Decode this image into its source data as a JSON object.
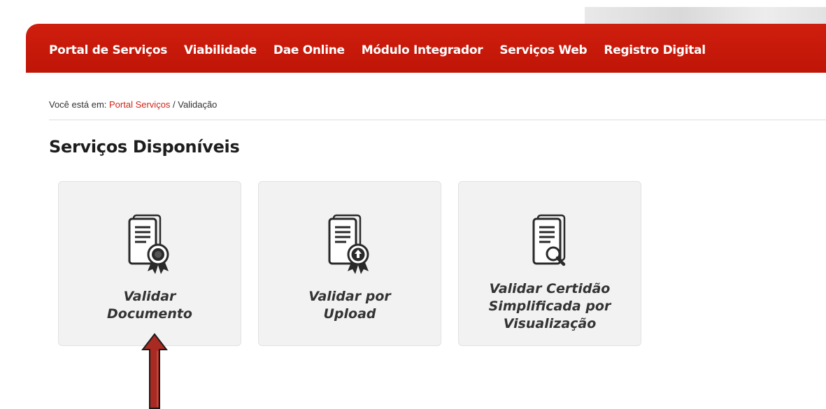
{
  "navbar": {
    "items": [
      {
        "label": "Portal de Serviços"
      },
      {
        "label": "Viabilidade"
      },
      {
        "label": "Dae Online"
      },
      {
        "label": "Módulo Integrador"
      },
      {
        "label": "Serviços Web"
      },
      {
        "label": "Registro Digital"
      }
    ]
  },
  "breadcrumb": {
    "prefix": "Você está em: ",
    "link": "Portal Serviços",
    "separator": " / ",
    "current": "Validação"
  },
  "section": {
    "title": "Serviços Disponíveis"
  },
  "cards": [
    {
      "label_line1": "Validar",
      "label_line2": "Documento",
      "icon": "document-seal-icon"
    },
    {
      "label_line1": "Validar por",
      "label_line2": "Upload",
      "icon": "document-upload-seal-icon"
    },
    {
      "label_line1": "Validar Certidão",
      "label_line2": "Simplificada por",
      "label_line3": "Visualização",
      "icon": "document-magnifier-icon"
    }
  ],
  "colors": {
    "navbar": "#c4170a",
    "link": "#d0241a",
    "card_bg": "#f2f2f2",
    "arrow": "#a82a22"
  }
}
